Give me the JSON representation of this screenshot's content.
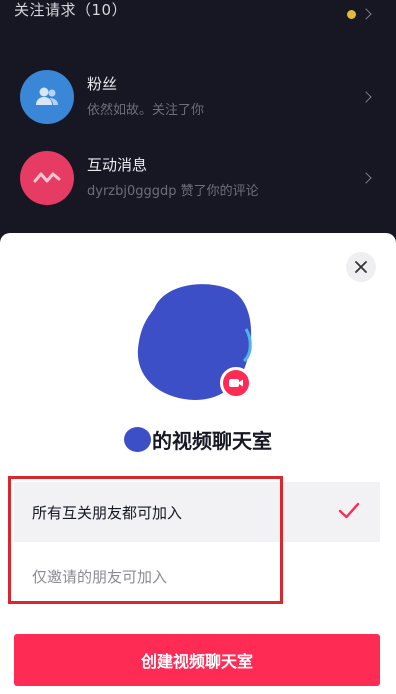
{
  "background": {
    "follow_requests_label": "关注请求（10）",
    "items": [
      {
        "title": "粉丝",
        "subtitle": "依然如故。关注了你",
        "icon": "users-icon",
        "color": "#3a87d8"
      },
      {
        "title": "互动消息",
        "subtitle": "dyrzbj0gggdp 赞了你的评论",
        "icon": "zigzag-icon",
        "color": "#e63b63"
      }
    ],
    "dot_color": "#e2b93b"
  },
  "sheet": {
    "title": "的视频聊天室",
    "options": [
      {
        "label": "所有互关朋友都可加入",
        "selected": true
      },
      {
        "label": "仅邀请的朋友可加入",
        "selected": false
      }
    ],
    "create_button_label": "创建视频聊天室",
    "accent_color": "#fe2c55"
  }
}
